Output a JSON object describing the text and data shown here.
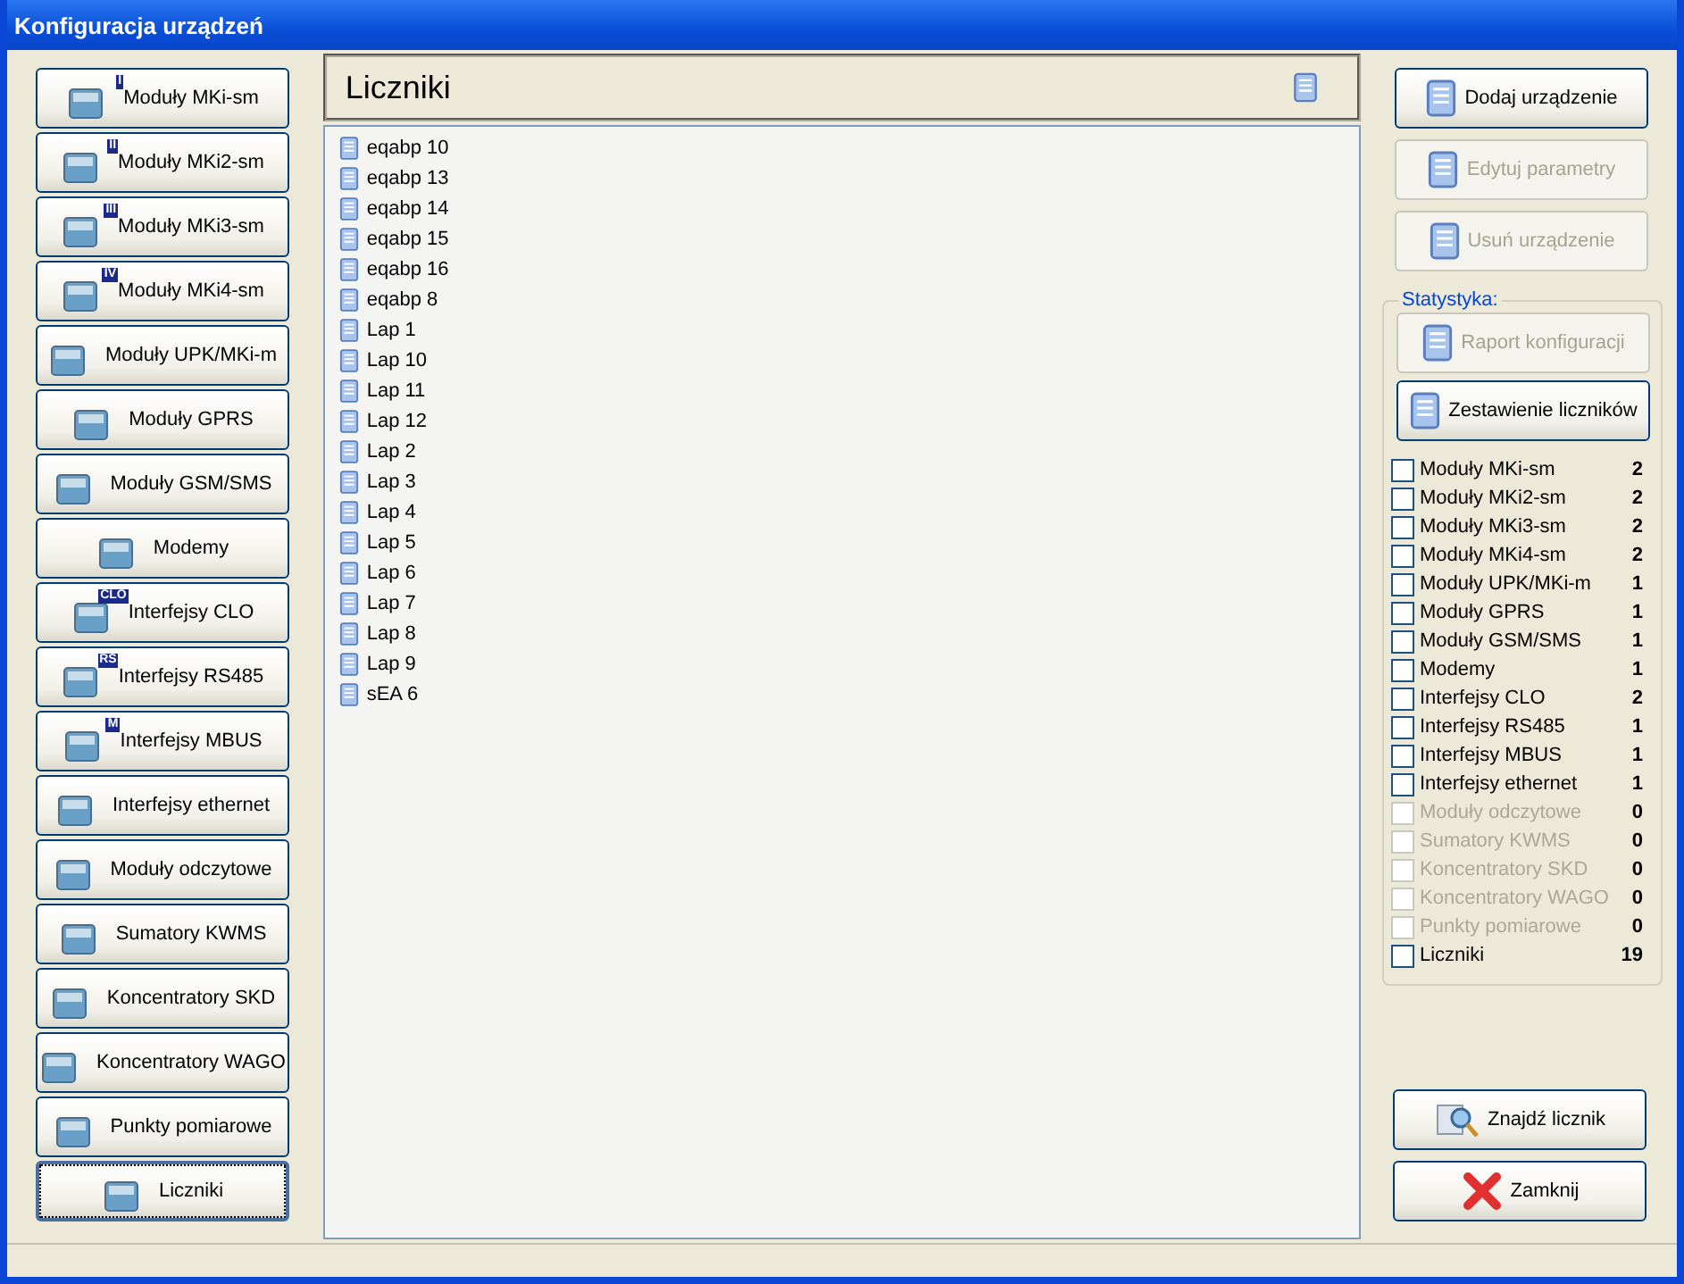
{
  "window": {
    "title": "Konfiguracja urządzeń"
  },
  "categories": [
    {
      "label": "Moduły MKi-sm",
      "badge": "I",
      "selected": false
    },
    {
      "label": "Moduły MKi2-sm",
      "badge": "II",
      "selected": false
    },
    {
      "label": "Moduły MKi3-sm",
      "badge": "III",
      "selected": false
    },
    {
      "label": "Moduły MKi4-sm",
      "badge": "IV",
      "selected": false
    },
    {
      "label": "Moduły UPK/MKi-m",
      "selected": false
    },
    {
      "label": "Moduły GPRS",
      "selected": false
    },
    {
      "label": "Moduły GSM/SMS",
      "selected": false
    },
    {
      "label": "Modemy",
      "selected": false
    },
    {
      "label": "Interfejsy CLO",
      "badge": "CLO",
      "selected": false
    },
    {
      "label": "Interfejsy RS485",
      "badge": "RS",
      "selected": false
    },
    {
      "label": "Interfejsy MBUS",
      "badge": "M",
      "selected": false
    },
    {
      "label": "Interfejsy ethernet",
      "selected": false
    },
    {
      "label": "Moduły odczytowe",
      "selected": false
    },
    {
      "label": "Sumatory KWMS",
      "selected": false
    },
    {
      "label": "Koncentratory SKD",
      "selected": false
    },
    {
      "label": "Koncentratory WAGO",
      "selected": false
    },
    {
      "label": "Punkty pomiarowe",
      "selected": false
    },
    {
      "label": "Liczniki",
      "selected": true
    }
  ],
  "list": {
    "title": "Liczniki",
    "items": [
      "eqabp 10",
      "eqabp 13",
      "eqabp 14",
      "eqabp 15",
      "eqabp 16",
      "eqabp 8",
      "Lap 1",
      "Lap 10",
      "Lap 11",
      "Lap 12",
      "Lap 2",
      "Lap 3",
      "Lap 4",
      "Lap 5",
      "Lap 6",
      "Lap 7",
      "Lap 8",
      "Lap 9",
      "sEA 6"
    ]
  },
  "actions": [
    {
      "label": "Dodaj urządzenie",
      "disabled": false
    },
    {
      "label": "Edytuj parametry",
      "disabled": true
    },
    {
      "label": "Usuń urządzenie",
      "disabled": true
    }
  ],
  "statistics": {
    "title": "Statystyka:",
    "buttons": [
      {
        "label": "Raport konfiguracji",
        "disabled": true
      },
      {
        "label": "Zestawienie liczników",
        "disabled": false
      }
    ],
    "rows": [
      {
        "label": "Moduły MKi-sm",
        "count": "2",
        "checked": false,
        "disabled": false
      },
      {
        "label": "Moduły MKi2-sm",
        "count": "2",
        "checked": false,
        "disabled": false
      },
      {
        "label": "Moduły MKi3-sm",
        "count": "2",
        "checked": false,
        "disabled": false
      },
      {
        "label": "Moduły MKi4-sm",
        "count": "2",
        "checked": false,
        "disabled": false
      },
      {
        "label": "Moduły UPK/MKi-m",
        "count": "1",
        "checked": false,
        "disabled": false
      },
      {
        "label": "Moduły GPRS",
        "count": "1",
        "checked": false,
        "disabled": false
      },
      {
        "label": "Moduły GSM/SMS",
        "count": "1",
        "checked": false,
        "disabled": false
      },
      {
        "label": "Modemy",
        "count": "1",
        "checked": false,
        "disabled": false
      },
      {
        "label": "Interfejsy CLO",
        "count": "2",
        "checked": false,
        "disabled": false
      },
      {
        "label": "Interfejsy RS485",
        "count": "1",
        "checked": false,
        "disabled": false
      },
      {
        "label": "Interfejsy MBUS",
        "count": "1",
        "checked": false,
        "disabled": false
      },
      {
        "label": "Interfejsy ethernet",
        "count": "1",
        "checked": false,
        "disabled": false
      },
      {
        "label": "Moduły odczytowe",
        "count": "0",
        "checked": false,
        "disabled": true
      },
      {
        "label": "Sumatory KWMS",
        "count": "0",
        "checked": false,
        "disabled": true
      },
      {
        "label": "Koncentratory SKD",
        "count": "0",
        "checked": false,
        "disabled": true
      },
      {
        "label": "Koncentratory WAGO",
        "count": "0",
        "checked": false,
        "disabled": true
      },
      {
        "label": "Punkty pomiarowe",
        "count": "0",
        "checked": false,
        "disabled": true
      },
      {
        "label": "Liczniki",
        "count": "19",
        "checked": false,
        "disabled": false
      }
    ]
  },
  "bottom_buttons": [
    {
      "label": "Znajdź licznik",
      "kind": "search"
    },
    {
      "label": "Zamknij",
      "kind": "close"
    }
  ]
}
